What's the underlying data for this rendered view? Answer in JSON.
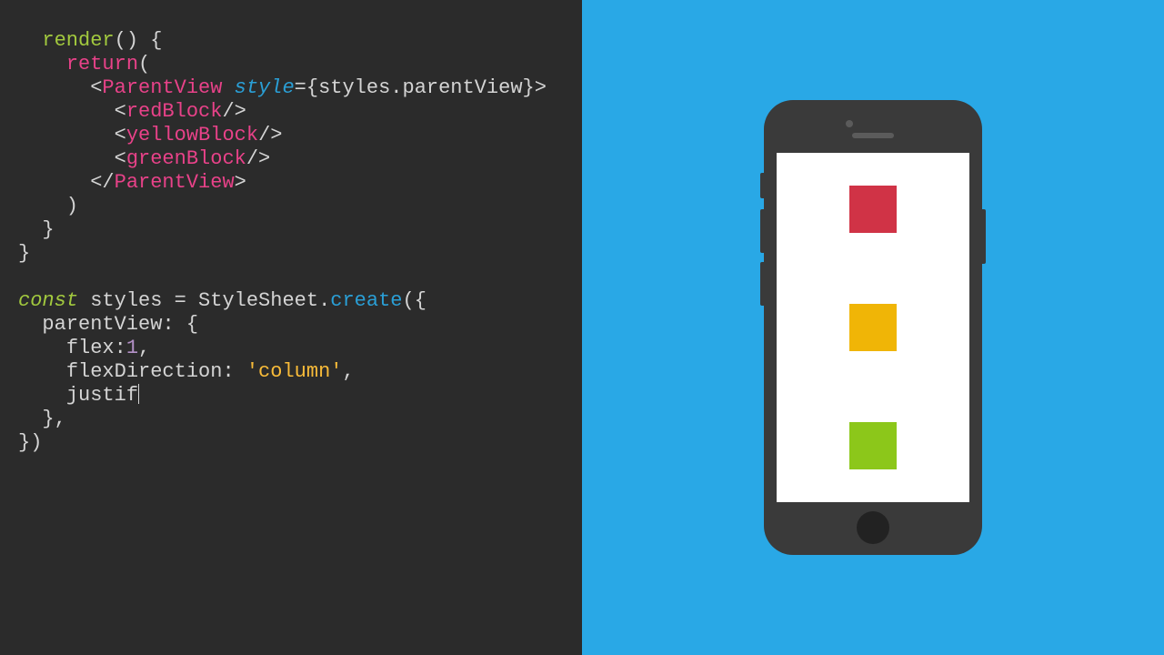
{
  "code": {
    "t_render": "render",
    "t_return": "return",
    "t_parentview_open": "ParentView",
    "t_style_attr": "style",
    "t_styles_ref": "styles",
    "t_parentview_prop": "parentView",
    "t_redblock": "redBlock",
    "t_yellowblock": "yellowBlock",
    "t_greenblock": "greenBlock",
    "t_parentview_close": "ParentView",
    "t_const": "const",
    "t_styles_var": "styles",
    "t_stylesheet": "StyleSheet",
    "t_create": "create",
    "t_parentview_key": "parentView",
    "t_flex": "flex",
    "n_flex": "1",
    "t_flexdir": "flexDirection",
    "s_column": "'column'",
    "t_justif": "justif"
  },
  "phone": {
    "blocks": {
      "red": "#d03346",
      "yellow": "#f0b506",
      "green": "#8cc71a"
    }
  }
}
